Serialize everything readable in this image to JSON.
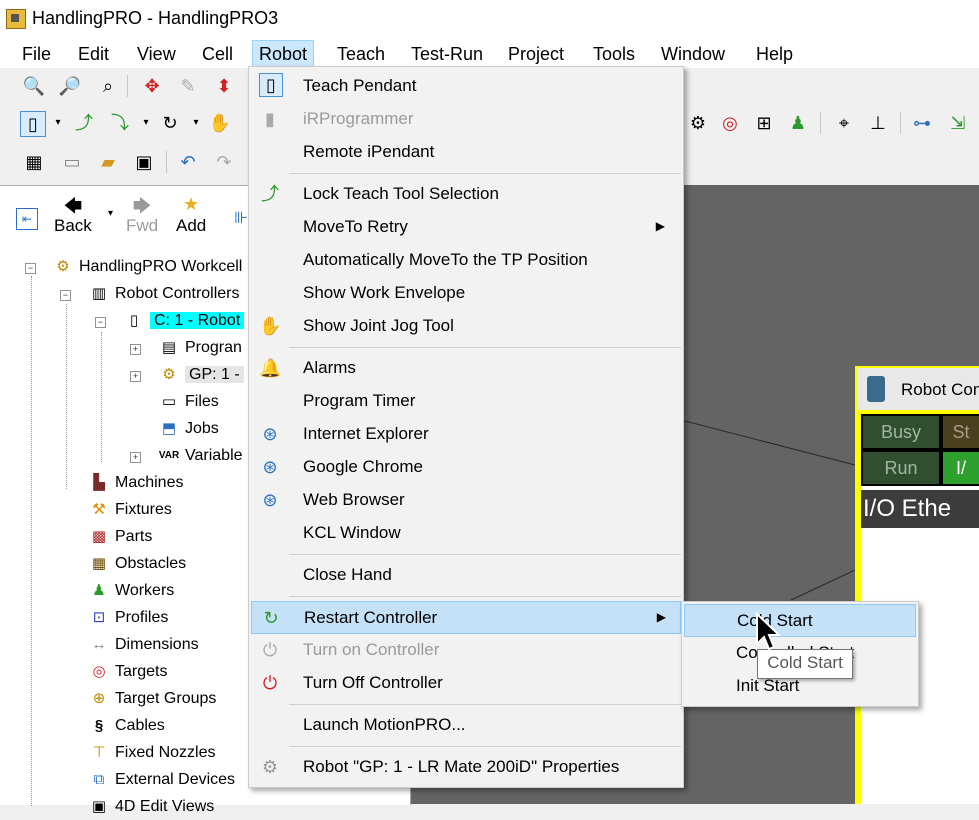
{
  "window": {
    "title": "HandlingPRO - HandlingPRO3"
  },
  "menubar": {
    "items": [
      "File",
      "Edit",
      "View",
      "Cell",
      "Robot",
      "Teach",
      "Test-Run",
      "Project",
      "Tools",
      "Window",
      "Help"
    ],
    "active": "Robot"
  },
  "nav": {
    "back": "Back",
    "fwd": "Fwd",
    "add": "Add"
  },
  "tree": {
    "root": "HandlingPRO Workcell",
    "robot_controllers": "Robot Controllers",
    "controller": "C: 1 - Robot",
    "programs": "Progran",
    "gp": "GP: 1 -",
    "files": "Files",
    "jobs": "Jobs",
    "variables": "Variable",
    "machines": "Machines",
    "fixtures": "Fixtures",
    "parts": "Parts",
    "obstacles": "Obstacles",
    "workers": "Workers",
    "profiles": "Profiles",
    "dimensions": "Dimensions",
    "targets": "Targets",
    "target_groups": "Target Groups",
    "cables": "Cables",
    "fixed_nozzles": "Fixed Nozzles",
    "external_devices": "External Devices",
    "edit_views": "4D Edit Views"
  },
  "robot_window": {
    "title": "Robot Cont",
    "busy": "Busy",
    "st": "St",
    "run": "Run",
    "io": "I/",
    "io_header": "I/O Ethe"
  },
  "robot_menu": {
    "teach_pendant": "Teach Pendant",
    "ir_programmer": "iRProgrammer",
    "remote_ipendant": "Remote iPendant",
    "lock_teach_tool": "Lock Teach Tool Selection",
    "moveto_retry": "MoveTo Retry",
    "auto_moveto": "Automatically MoveTo the TP Position",
    "show_work_envelope": "Show Work Envelope",
    "show_joint_jog": "Show Joint Jog Tool",
    "alarms": "Alarms",
    "program_timer": "Program Timer",
    "internet_explorer": "Internet Explorer",
    "google_chrome": "Google Chrome",
    "web_browser": "Web Browser",
    "kcl_window": "KCL Window",
    "close_hand": "Close Hand",
    "restart_controller": "Restart Controller",
    "turn_on_controller": "Turn on Controller",
    "turn_off_controller": "Turn Off Controller",
    "launch_motionpro": "Launch MotionPRO...",
    "robot_properties": "Robot \"GP: 1 - LR Mate 200iD\" Properties"
  },
  "restart_submenu": {
    "cold_start": "Cold Start",
    "controlled_start": "Controlled Start",
    "init_start": "Init Start"
  },
  "tooltip": "Cold Start"
}
